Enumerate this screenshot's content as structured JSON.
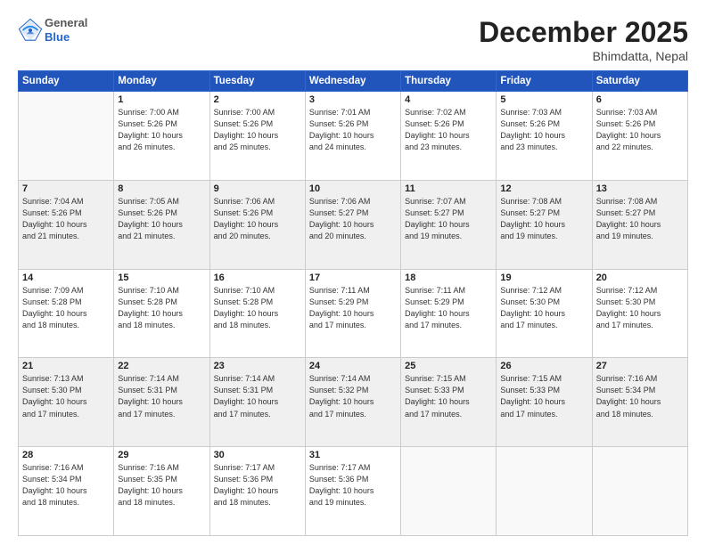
{
  "logo": {
    "general": "General",
    "blue": "Blue"
  },
  "title": {
    "month": "December 2025",
    "location": "Bhimdatta, Nepal"
  },
  "weekdays": [
    "Sunday",
    "Monday",
    "Tuesday",
    "Wednesday",
    "Thursday",
    "Friday",
    "Saturday"
  ],
  "weeks": [
    [
      {
        "day": "",
        "info": ""
      },
      {
        "day": "1",
        "info": "Sunrise: 7:00 AM\nSunset: 5:26 PM\nDaylight: 10 hours\nand 26 minutes."
      },
      {
        "day": "2",
        "info": "Sunrise: 7:00 AM\nSunset: 5:26 PM\nDaylight: 10 hours\nand 25 minutes."
      },
      {
        "day": "3",
        "info": "Sunrise: 7:01 AM\nSunset: 5:26 PM\nDaylight: 10 hours\nand 24 minutes."
      },
      {
        "day": "4",
        "info": "Sunrise: 7:02 AM\nSunset: 5:26 PM\nDaylight: 10 hours\nand 23 minutes."
      },
      {
        "day": "5",
        "info": "Sunrise: 7:03 AM\nSunset: 5:26 PM\nDaylight: 10 hours\nand 23 minutes."
      },
      {
        "day": "6",
        "info": "Sunrise: 7:03 AM\nSunset: 5:26 PM\nDaylight: 10 hours\nand 22 minutes."
      }
    ],
    [
      {
        "day": "7",
        "info": "Sunrise: 7:04 AM\nSunset: 5:26 PM\nDaylight: 10 hours\nand 21 minutes."
      },
      {
        "day": "8",
        "info": "Sunrise: 7:05 AM\nSunset: 5:26 PM\nDaylight: 10 hours\nand 21 minutes."
      },
      {
        "day": "9",
        "info": "Sunrise: 7:06 AM\nSunset: 5:26 PM\nDaylight: 10 hours\nand 20 minutes."
      },
      {
        "day": "10",
        "info": "Sunrise: 7:06 AM\nSunset: 5:27 PM\nDaylight: 10 hours\nand 20 minutes."
      },
      {
        "day": "11",
        "info": "Sunrise: 7:07 AM\nSunset: 5:27 PM\nDaylight: 10 hours\nand 19 minutes."
      },
      {
        "day": "12",
        "info": "Sunrise: 7:08 AM\nSunset: 5:27 PM\nDaylight: 10 hours\nand 19 minutes."
      },
      {
        "day": "13",
        "info": "Sunrise: 7:08 AM\nSunset: 5:27 PM\nDaylight: 10 hours\nand 19 minutes."
      }
    ],
    [
      {
        "day": "14",
        "info": "Sunrise: 7:09 AM\nSunset: 5:28 PM\nDaylight: 10 hours\nand 18 minutes."
      },
      {
        "day": "15",
        "info": "Sunrise: 7:10 AM\nSunset: 5:28 PM\nDaylight: 10 hours\nand 18 minutes."
      },
      {
        "day": "16",
        "info": "Sunrise: 7:10 AM\nSunset: 5:28 PM\nDaylight: 10 hours\nand 18 minutes."
      },
      {
        "day": "17",
        "info": "Sunrise: 7:11 AM\nSunset: 5:29 PM\nDaylight: 10 hours\nand 17 minutes."
      },
      {
        "day": "18",
        "info": "Sunrise: 7:11 AM\nSunset: 5:29 PM\nDaylight: 10 hours\nand 17 minutes."
      },
      {
        "day": "19",
        "info": "Sunrise: 7:12 AM\nSunset: 5:30 PM\nDaylight: 10 hours\nand 17 minutes."
      },
      {
        "day": "20",
        "info": "Sunrise: 7:12 AM\nSunset: 5:30 PM\nDaylight: 10 hours\nand 17 minutes."
      }
    ],
    [
      {
        "day": "21",
        "info": "Sunrise: 7:13 AM\nSunset: 5:30 PM\nDaylight: 10 hours\nand 17 minutes."
      },
      {
        "day": "22",
        "info": "Sunrise: 7:14 AM\nSunset: 5:31 PM\nDaylight: 10 hours\nand 17 minutes."
      },
      {
        "day": "23",
        "info": "Sunrise: 7:14 AM\nSunset: 5:31 PM\nDaylight: 10 hours\nand 17 minutes."
      },
      {
        "day": "24",
        "info": "Sunrise: 7:14 AM\nSunset: 5:32 PM\nDaylight: 10 hours\nand 17 minutes."
      },
      {
        "day": "25",
        "info": "Sunrise: 7:15 AM\nSunset: 5:33 PM\nDaylight: 10 hours\nand 17 minutes."
      },
      {
        "day": "26",
        "info": "Sunrise: 7:15 AM\nSunset: 5:33 PM\nDaylight: 10 hours\nand 17 minutes."
      },
      {
        "day": "27",
        "info": "Sunrise: 7:16 AM\nSunset: 5:34 PM\nDaylight: 10 hours\nand 18 minutes."
      }
    ],
    [
      {
        "day": "28",
        "info": "Sunrise: 7:16 AM\nSunset: 5:34 PM\nDaylight: 10 hours\nand 18 minutes."
      },
      {
        "day": "29",
        "info": "Sunrise: 7:16 AM\nSunset: 5:35 PM\nDaylight: 10 hours\nand 18 minutes."
      },
      {
        "day": "30",
        "info": "Sunrise: 7:17 AM\nSunset: 5:36 PM\nDaylight: 10 hours\nand 18 minutes."
      },
      {
        "day": "31",
        "info": "Sunrise: 7:17 AM\nSunset: 5:36 PM\nDaylight: 10 hours\nand 19 minutes."
      },
      {
        "day": "",
        "info": ""
      },
      {
        "day": "",
        "info": ""
      },
      {
        "day": "",
        "info": ""
      }
    ]
  ]
}
